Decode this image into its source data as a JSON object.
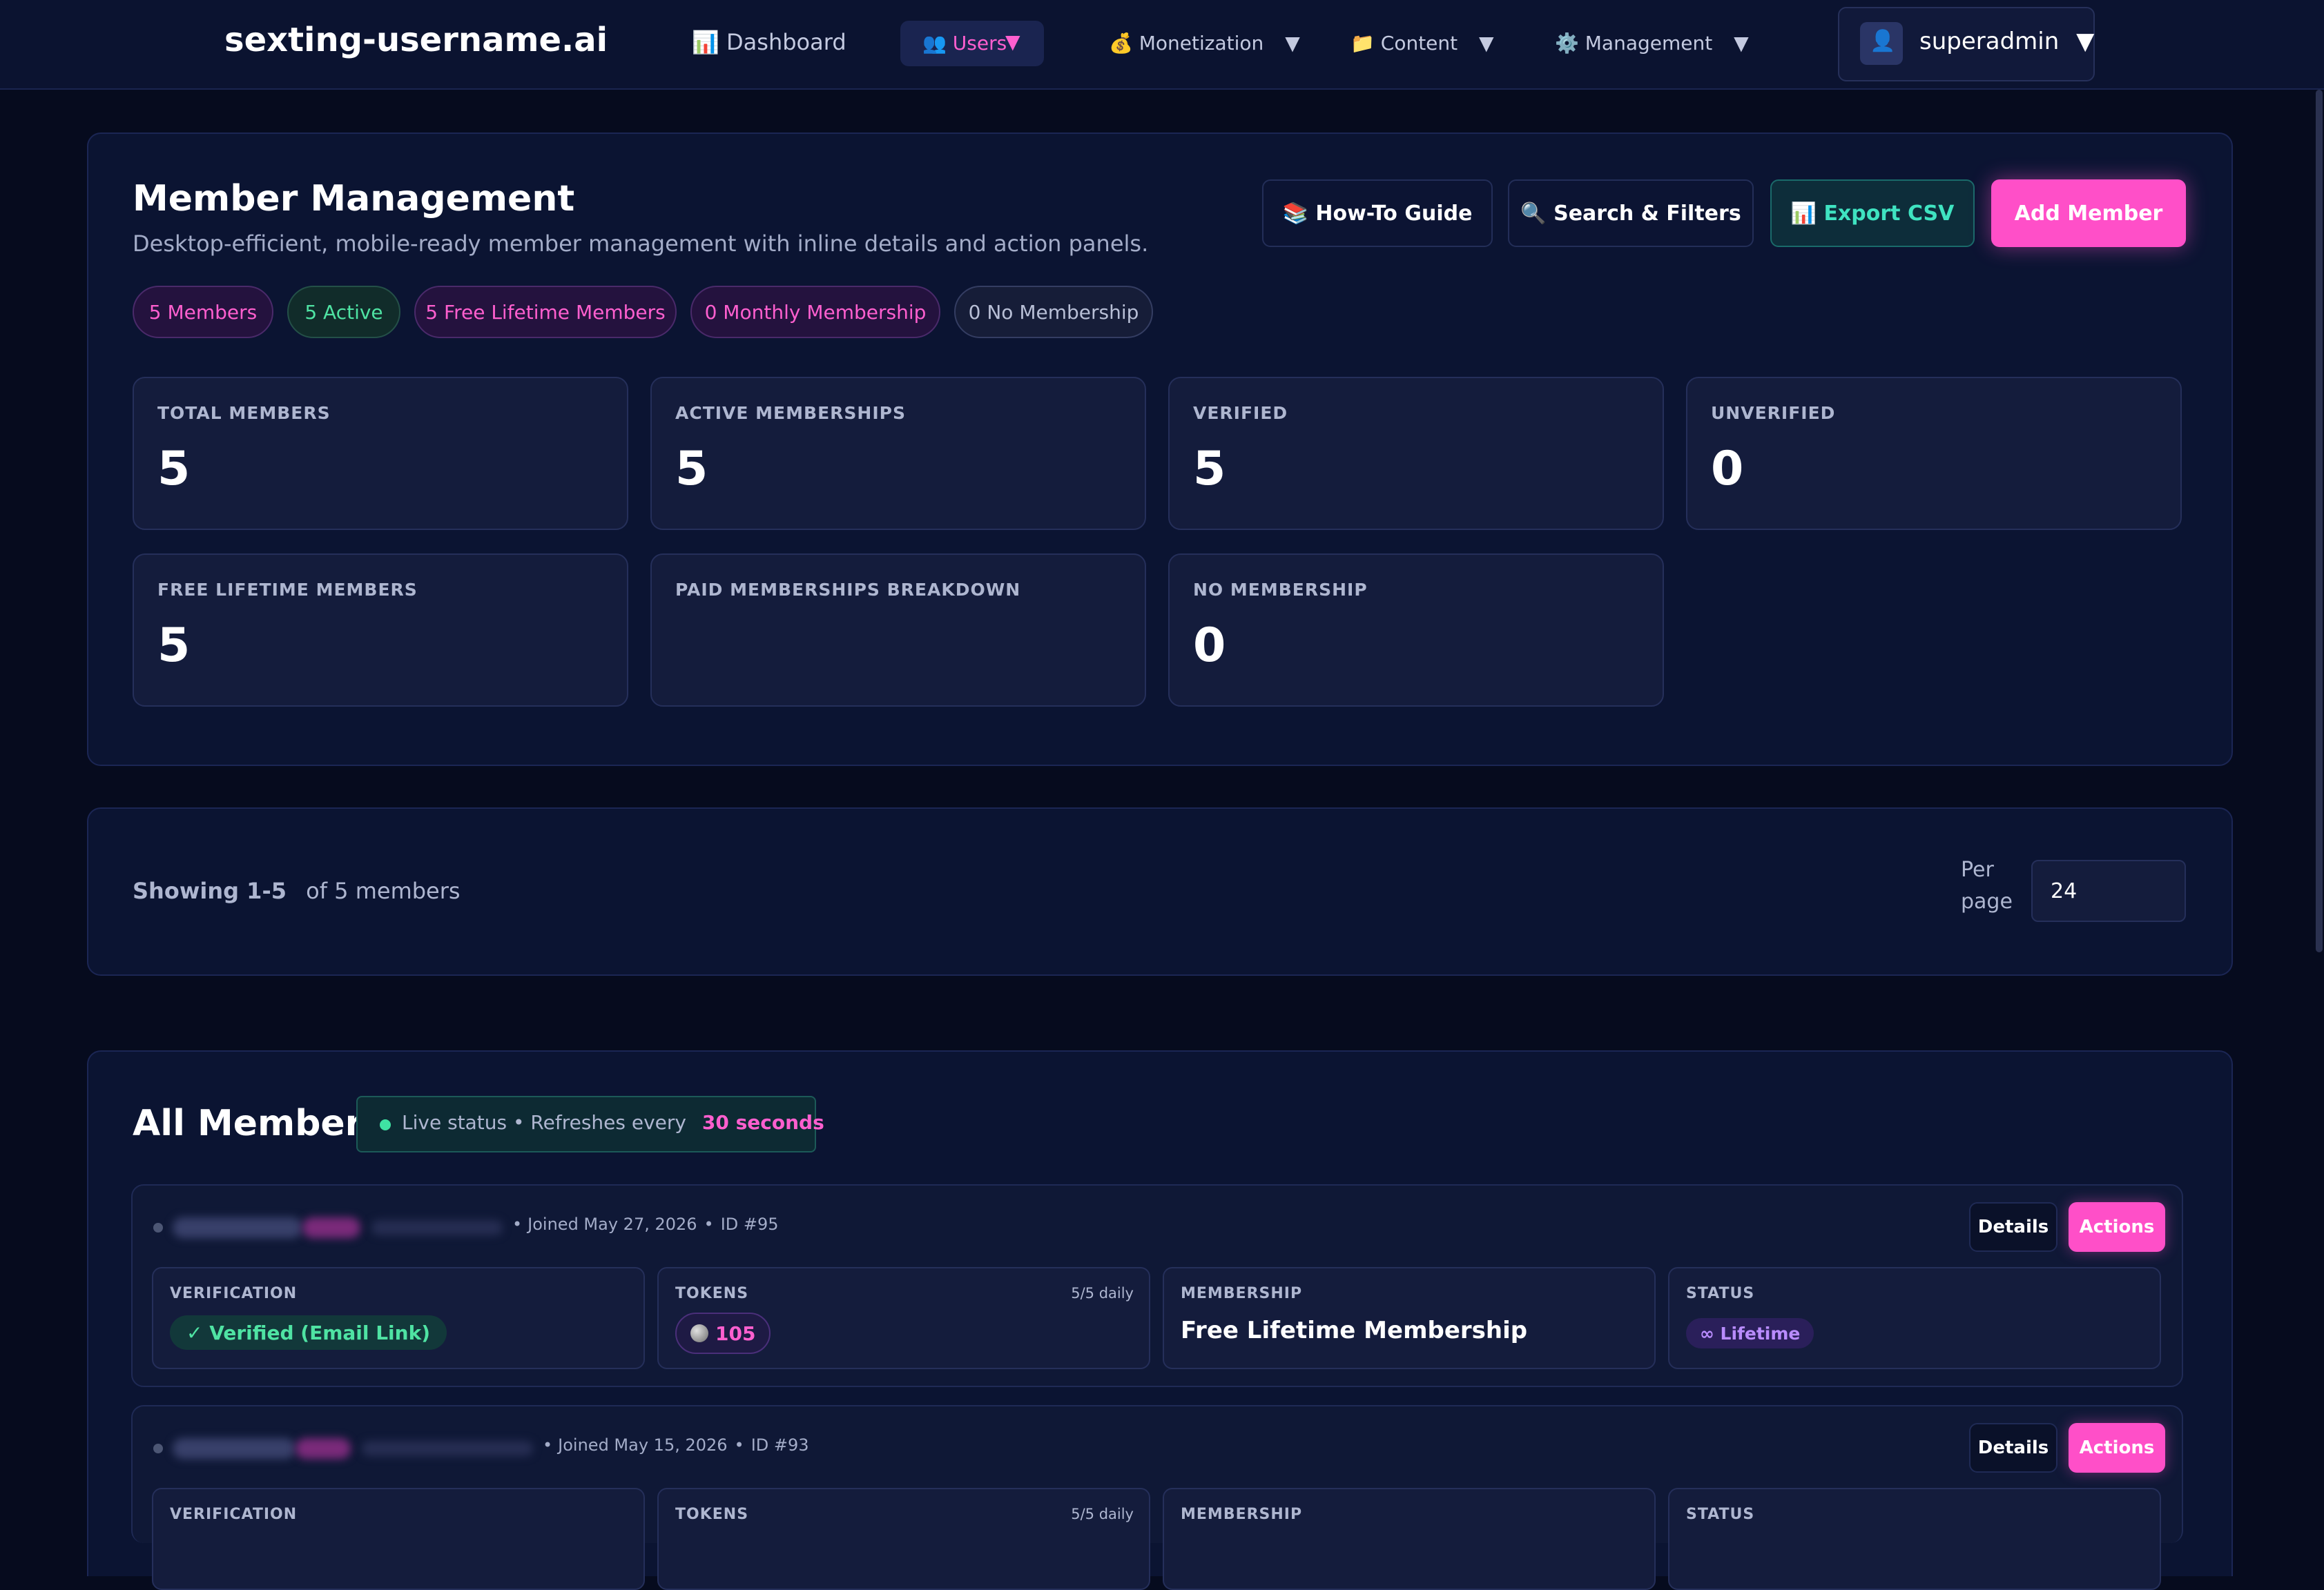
{
  "nav": {
    "brand": "sexting-username.ai",
    "dashboard_label": "📊 Dashboard",
    "users_label": "👥 Users",
    "monetization_label": "💰 Monetization",
    "content_label": "📁 Content",
    "management_label": "⚙️ Management",
    "caret": "▼",
    "user_name": "superadmin",
    "avatar_icon": "👤"
  },
  "header": {
    "title": "Member Management",
    "subtitle": "Desktop-efficient, mobile-ready member management with inline details and action panels.",
    "buttons": {
      "guide": "📚 How-To Guide",
      "search": "🔍 Search & Filters",
      "export": "📊 Export CSV",
      "add": "Add Member"
    },
    "chips": [
      "5 Members",
      "5 Active",
      "5 Free Lifetime Members",
      "0 Monthly Membership",
      "0 No Membership"
    ]
  },
  "stats": [
    {
      "label": "TOTAL MEMBERS",
      "value": "5"
    },
    {
      "label": "ACTIVE MEMBERSHIPS",
      "value": "5"
    },
    {
      "label": "VERIFIED",
      "value": "5"
    },
    {
      "label": "UNVERIFIED",
      "value": "0"
    },
    {
      "label": "FREE LIFETIME MEMBERS",
      "value": "5"
    },
    {
      "label": "PAID MEMBERSHIPS BREAKDOWN",
      "value": ""
    },
    {
      "label": "NO MEMBERSHIP",
      "value": "0"
    }
  ],
  "pagination": {
    "showing": "Showing 1-5",
    "of_total": "of 5 members",
    "per_page_label_1": "Per",
    "per_page_label_2": "page",
    "per_page_value": "24"
  },
  "members_section": {
    "title": "All Members",
    "live_prefix": "Live status • Refreshes every",
    "live_interval": "30 seconds"
  },
  "members": [
    {
      "joined": "Joined May 27, 2026",
      "id": "ID #95",
      "details_label": "Details",
      "actions_label": "Actions",
      "verification_label": "VERIFICATION",
      "verification_value": "✓ Verified (Email Link)",
      "tokens_label": "TOKENS",
      "tokens_daily": "5/5 daily",
      "tokens_value": "105",
      "membership_label": "MEMBERSHIP",
      "membership_value": "Free Lifetime Membership",
      "status_label": "STATUS",
      "status_value": "∞ Lifetime"
    },
    {
      "joined": "Joined May 15, 2026",
      "id": "ID #93",
      "details_label": "Details",
      "actions_label": "Actions",
      "verification_label": "VERIFICATION",
      "tokens_label": "TOKENS",
      "tokens_daily": "5/5 daily",
      "membership_label": "MEMBERSHIP",
      "status_label": "STATUS"
    }
  ],
  "colors": {
    "accent_pink": "#ff4fc8",
    "accent_teal": "#3fe3c1",
    "background": "#060b1e"
  }
}
